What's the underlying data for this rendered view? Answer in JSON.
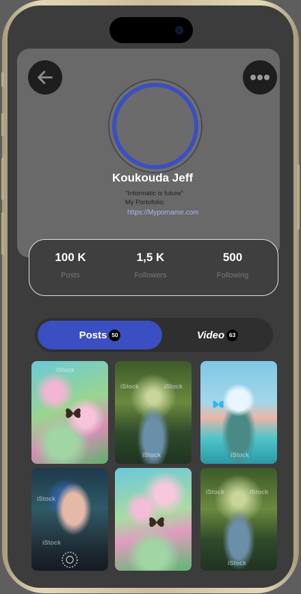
{
  "profile": {
    "name": "Koukouda Jeff",
    "quote": "\"Informatic is future\"",
    "portfolio_label": "My Portofolio:",
    "portfolio_link": "https://Myporname.com"
  },
  "stats": [
    {
      "value": "100 K",
      "label": "Posts"
    },
    {
      "value": "1,5 K",
      "label": "Followers"
    },
    {
      "value": "500",
      "label": "Following"
    }
  ],
  "tabs": [
    {
      "label": "Posts",
      "count": "50",
      "active": true
    },
    {
      "label": "Video",
      "count": "63",
      "active": false
    }
  ],
  "gallery": {
    "watermark": "iStock",
    "items": [
      "pink-flowers-butterfly",
      "enchanted-forest-pond",
      "astronaut-butterflies",
      "woman-butterfly-portrait",
      "pink-flowers-butterfly",
      "enchanted-forest-pond"
    ]
  },
  "colors": {
    "accent": "#3b4fc2",
    "link": "#aab8ff",
    "card": "#696969"
  },
  "icons": {
    "back": "arrow-left-icon",
    "more": "more-horizontal-icon"
  }
}
